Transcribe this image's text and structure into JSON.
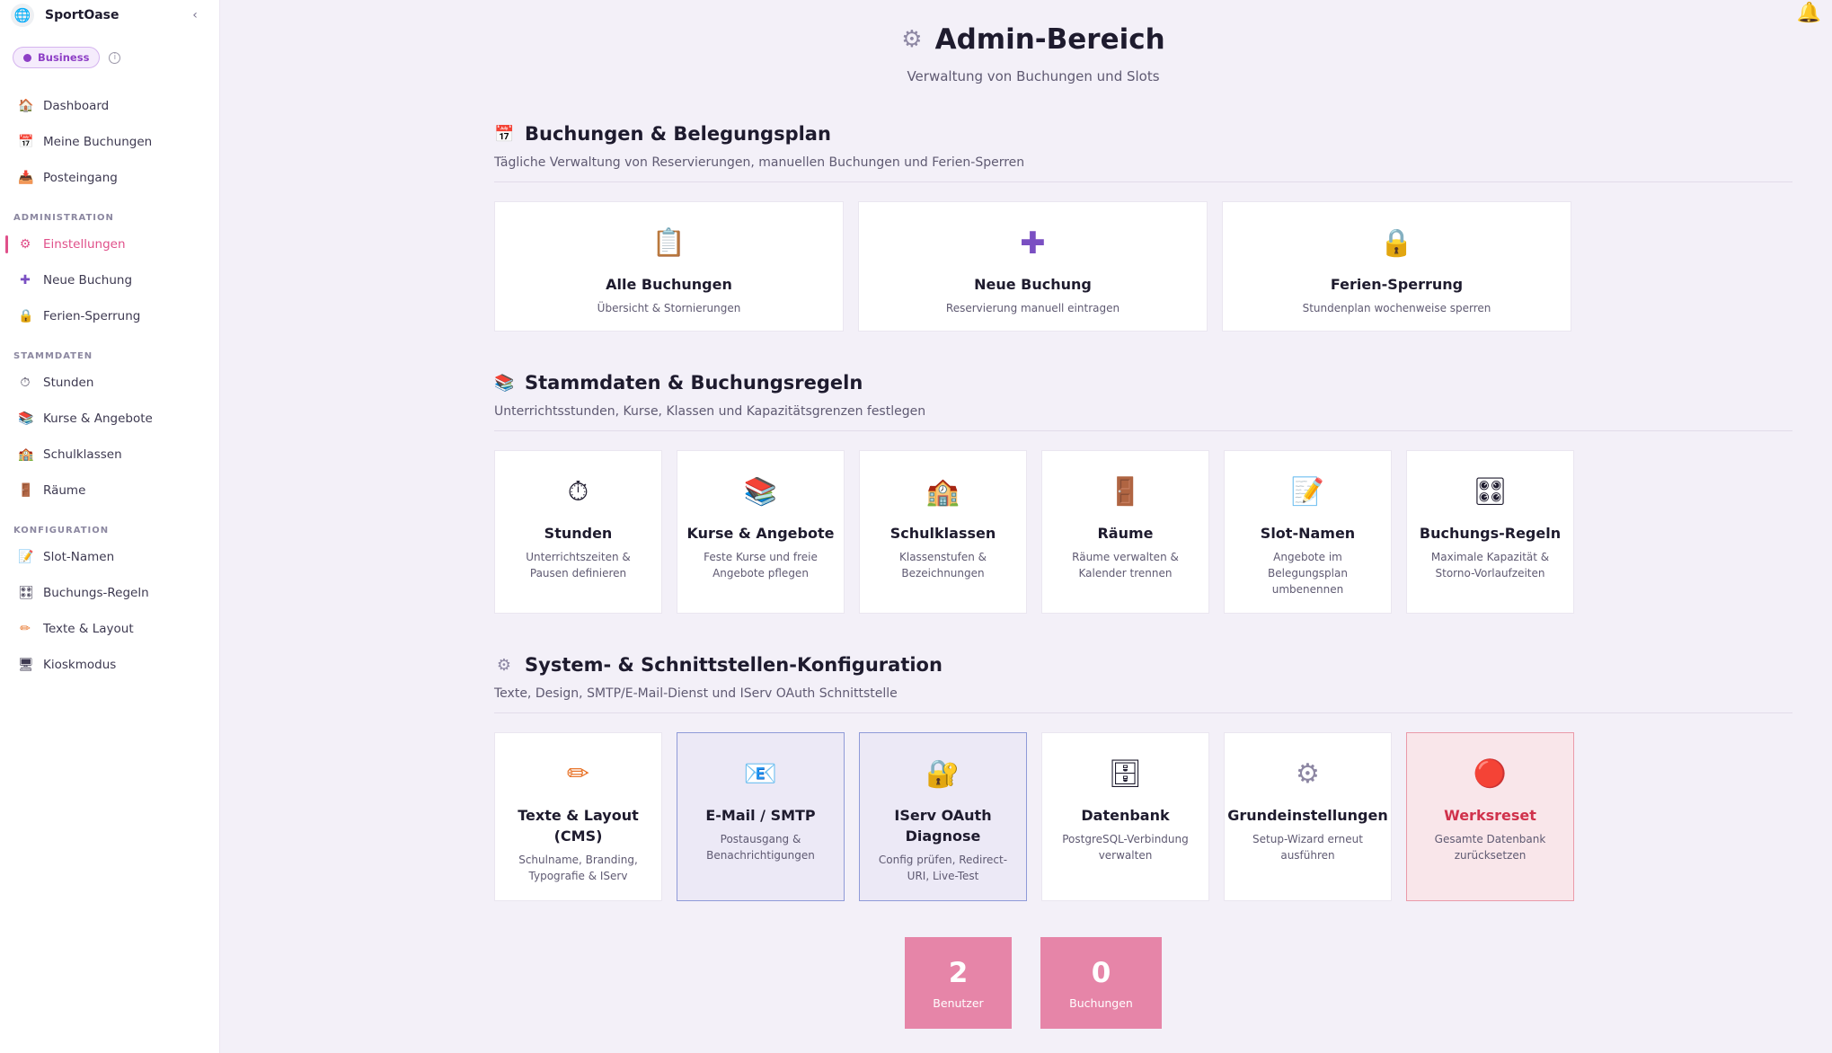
{
  "sidebar": {
    "brand_name": "SportOase",
    "plan_label": "Business",
    "items_top": [
      {
        "label": "Dashboard",
        "icon": "house-icon",
        "glyph": "🏠"
      },
      {
        "label": "Meine Buchungen",
        "icon": "calendar-icon",
        "glyph": "📅"
      },
      {
        "label": "Posteingang",
        "icon": "inbox-icon",
        "glyph": "📥"
      }
    ],
    "section_admin": "ADMINISTRATION",
    "items_admin": [
      {
        "label": "Einstellungen",
        "icon": "gear-icon",
        "glyph": "⚙"
      },
      {
        "label": "Neue Buchung",
        "icon": "plus-icon",
        "glyph": "✚"
      },
      {
        "label": "Ferien-Sperrung",
        "icon": "lock-icon",
        "glyph": "🔒"
      }
    ],
    "section_stammdaten": "STAMMDATEN",
    "items_stammdaten": [
      {
        "label": "Stunden",
        "icon": "stopwatch-icon",
        "glyph": "⏱"
      },
      {
        "label": "Kurse & Angebote",
        "icon": "books-icon",
        "glyph": "📚"
      },
      {
        "label": "Schulklassen",
        "icon": "school-icon",
        "glyph": "🏫"
      },
      {
        "label": "Räume",
        "icon": "door-icon",
        "glyph": "🚪"
      }
    ],
    "section_konfiguration": "KONFIGURATION",
    "items_konfiguration": [
      {
        "label": "Slot-Namen",
        "icon": "memo-icon",
        "glyph": "📝"
      },
      {
        "label": "Buchungs-Regeln",
        "icon": "control-knobs-icon",
        "glyph": "🎛"
      },
      {
        "label": "Texte & Layout",
        "icon": "pencil-icon",
        "glyph": "✏"
      },
      {
        "label": "Kioskmodus",
        "icon": "monitor-icon",
        "glyph": "🖥"
      }
    ]
  },
  "header": {
    "title": "Admin-Bereich",
    "subtitle": "Verwaltung von Buchungen und Slots"
  },
  "sections": {
    "bookings": {
      "title": "Buchungen & Belegungsplan",
      "subtitle": "Tägliche Verwaltung von Reservierungen, manuellen Buchungen und Ferien-Sperren",
      "cards": [
        {
          "title": "Alle Buchungen",
          "desc": "Übersicht & Stornierungen",
          "icon": "clipboard-icon",
          "glyph": "📋"
        },
        {
          "title": "Neue Buchung",
          "desc": "Reservierung manuell eintragen",
          "icon": "plus-icon",
          "glyph": "✚"
        },
        {
          "title": "Ferien-Sperrung",
          "desc": "Stundenplan wochenweise sperren",
          "icon": "lock-icon",
          "glyph": "🔒"
        }
      ]
    },
    "master": {
      "title": "Stammdaten & Buchungsregeln",
      "subtitle": "Unterrichtsstunden, Kurse, Klassen und Kapazitätsgrenzen festlegen",
      "cards": [
        {
          "title": "Stunden",
          "desc": "Unterrichtszeiten & Pausen definieren",
          "icon": "stopwatch-icon",
          "glyph": "⏱"
        },
        {
          "title": "Kurse & Angebote",
          "desc": "Feste Kurse und freie Angebote pflegen",
          "icon": "books-icon",
          "glyph": "📚"
        },
        {
          "title": "Schulklassen",
          "desc": "Klassenstufen & Bezeichnungen",
          "icon": "school-icon",
          "glyph": "🏫"
        },
        {
          "title": "Räume",
          "desc": "Räume verwalten & Kalender trennen",
          "icon": "door-icon",
          "glyph": "🚪"
        },
        {
          "title": "Slot-Namen",
          "desc": "Angebote im Belegungsplan umbenennen",
          "icon": "memo-icon",
          "glyph": "📝"
        },
        {
          "title": "Buchungs-Regeln",
          "desc": "Maximale Kapazität & Storno-Vorlaufzeiten",
          "icon": "control-knobs-icon",
          "glyph": "🎛"
        }
      ]
    },
    "system": {
      "title": "System- & Schnittstellen-Konfiguration",
      "subtitle": "Texte, Design, SMTP/E-Mail-Dienst und IServ OAuth Schnittstelle",
      "cards": [
        {
          "title": "Texte & Layout (CMS)",
          "desc": "Schulname, Branding, Typografie & IServ",
          "icon": "pencil-icon",
          "glyph": "✏"
        },
        {
          "title": "E-Mail / SMTP",
          "desc": "Postausgang & Benachrichtigungen",
          "icon": "email-icon",
          "glyph": "📧"
        },
        {
          "title": "IServ OAuth Diagnose",
          "desc": "Config prüfen, Redirect-URI, Live-Test",
          "icon": "lock-key-icon",
          "glyph": "🔐"
        },
        {
          "title": "Datenbank",
          "desc": "PostgreSQL-Verbindung verwalten",
          "icon": "database-icon",
          "glyph": "🗄"
        },
        {
          "title": "Grundeinstellungen",
          "desc": "Setup-Wizard erneut ausführen",
          "icon": "gear-icon",
          "glyph": "⚙"
        },
        {
          "title": "Werksreset",
          "desc": "Gesamte Datenbank zurücksetzen",
          "icon": "red-circle-icon",
          "glyph": "🔴"
        }
      ]
    }
  },
  "stats": {
    "users_value": "2",
    "users_label": "Benutzer",
    "bookings_value": "0",
    "bookings_label": "Buchungen"
  },
  "colors": {
    "accent": "#e0508a",
    "plan_badge": "#8e3fc6",
    "stat_tile": "#e685a8",
    "danger": "#d0324c"
  }
}
